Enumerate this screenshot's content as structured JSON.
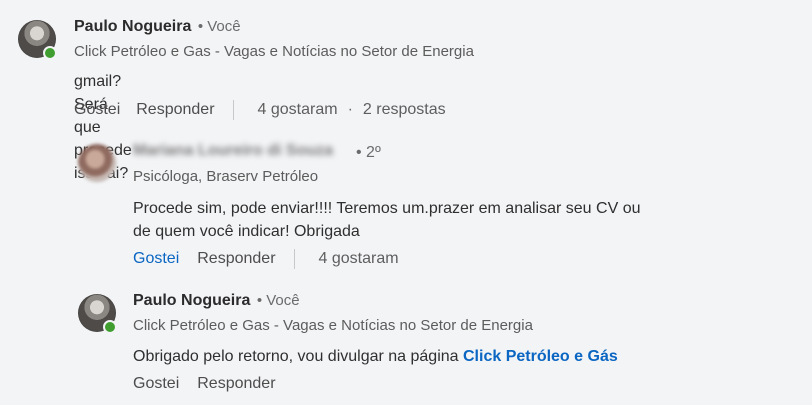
{
  "comments": [
    {
      "author": "Paulo Nogueira",
      "degree": "• Você",
      "headline": "Click Petróleo e Gas - Vagas e Notícias no Setor de Energia",
      "text": "gmail? Será que procede isso ai?",
      "like_label": "Gostei",
      "reply_label": "Responder",
      "likes": "4 gostaram",
      "dot": "·",
      "replies": "2 respostas"
    }
  ],
  "replies": [
    {
      "author": "Mariana Loureiro di Souza",
      "degree": "• 2º",
      "headline": "Psicóloga, Braserv Petróleo",
      "text_line1": "Procede sim, pode enviar!!!! Teremos um.prazer em analisar seu CV ou",
      "text_line2": "de quem você indicar! Obrigada",
      "like_label": "Gostei",
      "reply_label": "Responder",
      "likes": "4 gostaram"
    },
    {
      "author": "Paulo Nogueira",
      "degree": "• Você",
      "headline": "Click Petróleo e Gas - Vagas e Notícias no Setor de Energia",
      "text": "Obrigado pelo retorno, vou divulgar na página ",
      "link_text": "Click Petróleo e Gás",
      "like_label": "Gostei",
      "reply_label": "Responder"
    }
  ],
  "colors": {
    "link": "#0a66c2",
    "presence": "#3f9e2f"
  }
}
